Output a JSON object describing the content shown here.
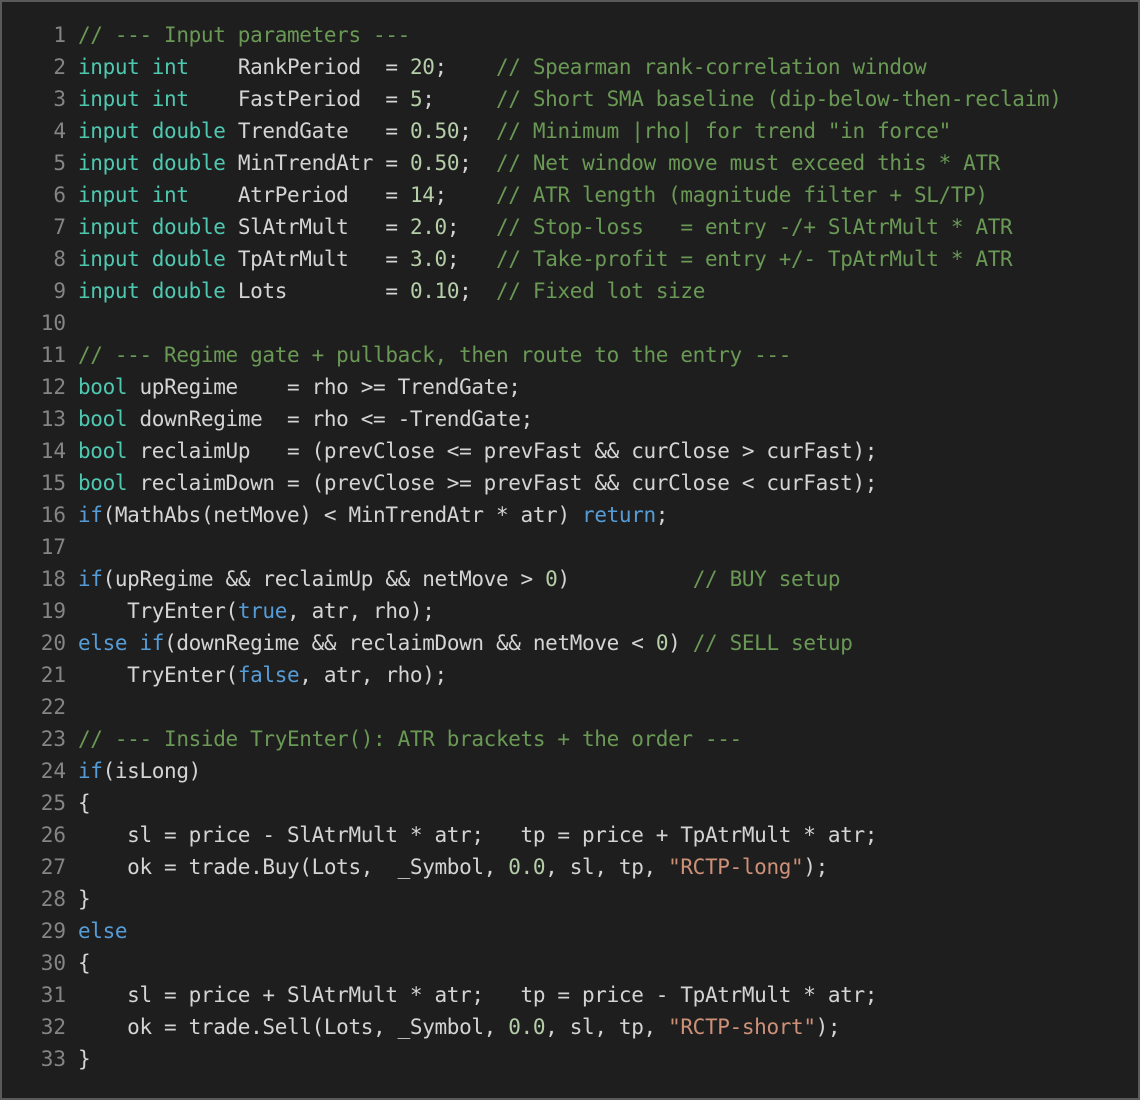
{
  "editor": {
    "colors": {
      "background": "#1e1e1e",
      "text": "#d4d4d4",
      "line_number": "#858585",
      "keyword": "#569cd6",
      "type": "#4ec9b0",
      "comment": "#6a9955",
      "number": "#b5cea8",
      "string": "#ce9178"
    },
    "lines": [
      {
        "n": "1",
        "tokens": [
          {
            "t": "// --- Input parameters ---",
            "c": "cm"
          }
        ]
      },
      {
        "n": "2",
        "tokens": [
          {
            "t": "input",
            "c": "ty"
          },
          {
            "t": " "
          },
          {
            "t": "int",
            "c": "ty"
          },
          {
            "t": "    RankPeriod  = "
          },
          {
            "t": "20",
            "c": "nu"
          },
          {
            "t": ";    "
          },
          {
            "t": "// Spearman rank-correlation window",
            "c": "cm"
          }
        ]
      },
      {
        "n": "3",
        "tokens": [
          {
            "t": "input",
            "c": "ty"
          },
          {
            "t": " "
          },
          {
            "t": "int",
            "c": "ty"
          },
          {
            "t": "    FastPeriod  = "
          },
          {
            "t": "5",
            "c": "nu"
          },
          {
            "t": ";     "
          },
          {
            "t": "// Short SMA baseline (dip-below-then-reclaim)",
            "c": "cm"
          }
        ]
      },
      {
        "n": "4",
        "tokens": [
          {
            "t": "input",
            "c": "ty"
          },
          {
            "t": " "
          },
          {
            "t": "double",
            "c": "ty"
          },
          {
            "t": " TrendGate   = "
          },
          {
            "t": "0.50",
            "c": "nu"
          },
          {
            "t": ";  "
          },
          {
            "t": "// Minimum |rho| for trend \"in force\"",
            "c": "cm"
          }
        ]
      },
      {
        "n": "5",
        "tokens": [
          {
            "t": "input",
            "c": "ty"
          },
          {
            "t": " "
          },
          {
            "t": "double",
            "c": "ty"
          },
          {
            "t": " MinTrendAtr = "
          },
          {
            "t": "0.50",
            "c": "nu"
          },
          {
            "t": ";  "
          },
          {
            "t": "// Net window move must exceed this * ATR",
            "c": "cm"
          }
        ]
      },
      {
        "n": "6",
        "tokens": [
          {
            "t": "input",
            "c": "ty"
          },
          {
            "t": " "
          },
          {
            "t": "int",
            "c": "ty"
          },
          {
            "t": "    AtrPeriod   = "
          },
          {
            "t": "14",
            "c": "nu"
          },
          {
            "t": ";    "
          },
          {
            "t": "// ATR length (magnitude filter + SL/TP)",
            "c": "cm"
          }
        ]
      },
      {
        "n": "7",
        "tokens": [
          {
            "t": "input",
            "c": "ty"
          },
          {
            "t": " "
          },
          {
            "t": "double",
            "c": "ty"
          },
          {
            "t": " SlAtrMult   = "
          },
          {
            "t": "2.0",
            "c": "nu"
          },
          {
            "t": ";   "
          },
          {
            "t": "// Stop-loss   = entry -/+ SlAtrMult * ATR",
            "c": "cm"
          }
        ]
      },
      {
        "n": "8",
        "tokens": [
          {
            "t": "input",
            "c": "ty"
          },
          {
            "t": " "
          },
          {
            "t": "double",
            "c": "ty"
          },
          {
            "t": " TpAtrMult   = "
          },
          {
            "t": "3.0",
            "c": "nu"
          },
          {
            "t": ";   "
          },
          {
            "t": "// Take-profit = entry +/- TpAtrMult * ATR",
            "c": "cm"
          }
        ]
      },
      {
        "n": "9",
        "tokens": [
          {
            "t": "input",
            "c": "ty"
          },
          {
            "t": " "
          },
          {
            "t": "double",
            "c": "ty"
          },
          {
            "t": " Lots        = "
          },
          {
            "t": "0.10",
            "c": "nu"
          },
          {
            "t": ";  "
          },
          {
            "t": "// Fixed lot size",
            "c": "cm"
          }
        ]
      },
      {
        "n": "10",
        "tokens": []
      },
      {
        "n": "11",
        "tokens": [
          {
            "t": "// --- Regime gate + pullback, then route to the entry ---",
            "c": "cm"
          }
        ]
      },
      {
        "n": "12",
        "tokens": [
          {
            "t": "bool",
            "c": "ty"
          },
          {
            "t": " upRegime    = rho >= TrendGate;"
          }
        ]
      },
      {
        "n": "13",
        "tokens": [
          {
            "t": "bool",
            "c": "ty"
          },
          {
            "t": " downRegime  = rho <= -TrendGate;"
          }
        ]
      },
      {
        "n": "14",
        "tokens": [
          {
            "t": "bool",
            "c": "ty"
          },
          {
            "t": " reclaimUp   = (prevClose <= prevFast && curClose > curFast);"
          }
        ]
      },
      {
        "n": "15",
        "tokens": [
          {
            "t": "bool",
            "c": "ty"
          },
          {
            "t": " reclaimDown = (prevClose >= prevFast && curClose < curFast);"
          }
        ]
      },
      {
        "n": "16",
        "tokens": [
          {
            "t": "if",
            "c": "kw"
          },
          {
            "t": "(MathAbs(netMove) < MinTrendAtr * atr) "
          },
          {
            "t": "return",
            "c": "kw"
          },
          {
            "t": ";"
          }
        ]
      },
      {
        "n": "17",
        "tokens": []
      },
      {
        "n": "18",
        "tokens": [
          {
            "t": "if",
            "c": "kw"
          },
          {
            "t": "(upRegime && reclaimUp && netMove > "
          },
          {
            "t": "0",
            "c": "nu"
          },
          {
            "t": ")          "
          },
          {
            "t": "// BUY setup",
            "c": "cm"
          }
        ]
      },
      {
        "n": "19",
        "tokens": [
          {
            "t": "    TryEnter("
          },
          {
            "t": "true",
            "c": "kw"
          },
          {
            "t": ", atr, rho);"
          }
        ]
      },
      {
        "n": "20",
        "tokens": [
          {
            "t": "else",
            "c": "kw"
          },
          {
            "t": " "
          },
          {
            "t": "if",
            "c": "kw"
          },
          {
            "t": "(downRegime && reclaimDown && netMove < "
          },
          {
            "t": "0",
            "c": "nu"
          },
          {
            "t": ") "
          },
          {
            "t": "// SELL setup",
            "c": "cm"
          }
        ]
      },
      {
        "n": "21",
        "tokens": [
          {
            "t": "    TryEnter("
          },
          {
            "t": "false",
            "c": "kw"
          },
          {
            "t": ", atr, rho);"
          }
        ]
      },
      {
        "n": "22",
        "tokens": []
      },
      {
        "n": "23",
        "tokens": [
          {
            "t": "// --- Inside TryEnter(): ATR brackets + the order ---",
            "c": "cm"
          }
        ]
      },
      {
        "n": "24",
        "tokens": [
          {
            "t": "if",
            "c": "kw"
          },
          {
            "t": "(isLong)"
          }
        ]
      },
      {
        "n": "25",
        "tokens": [
          {
            "t": "{"
          }
        ]
      },
      {
        "n": "26",
        "tokens": [
          {
            "t": "    sl = price - SlAtrMult * atr;   tp = price + TpAtrMult * atr;"
          }
        ]
      },
      {
        "n": "27",
        "tokens": [
          {
            "t": "    ok = trade.Buy(Lots,  _Symbol, "
          },
          {
            "t": "0.0",
            "c": "nu"
          },
          {
            "t": ", sl, tp, "
          },
          {
            "t": "\"RCTP-long\"",
            "c": "st"
          },
          {
            "t": ");"
          }
        ]
      },
      {
        "n": "28",
        "tokens": [
          {
            "t": "}"
          }
        ]
      },
      {
        "n": "29",
        "tokens": [
          {
            "t": "else",
            "c": "kw"
          }
        ]
      },
      {
        "n": "30",
        "tokens": [
          {
            "t": "{"
          }
        ]
      },
      {
        "n": "31",
        "tokens": [
          {
            "t": "    sl = price + SlAtrMult * atr;   tp = price - TpAtrMult * atr;"
          }
        ]
      },
      {
        "n": "32",
        "tokens": [
          {
            "t": "    ok = trade.Sell(Lots, _Symbol, "
          },
          {
            "t": "0.0",
            "c": "nu"
          },
          {
            "t": ", sl, tp, "
          },
          {
            "t": "\"RCTP-short\"",
            "c": "st"
          },
          {
            "t": ");"
          }
        ]
      },
      {
        "n": "33",
        "tokens": [
          {
            "t": "}"
          }
        ]
      }
    ]
  }
}
